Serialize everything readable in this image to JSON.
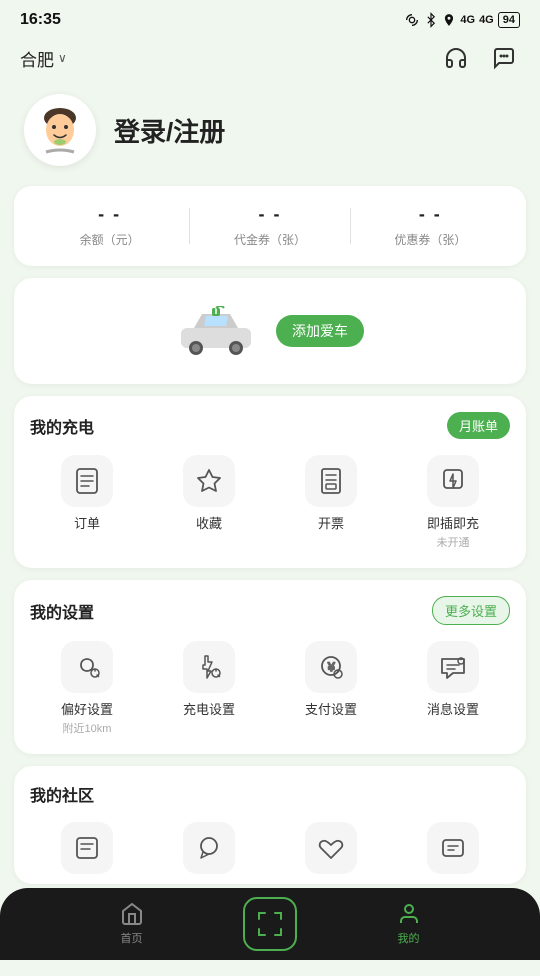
{
  "statusBar": {
    "time": "16:35",
    "icons": "NFC BT GPS Vol 4G 4G 94%"
  },
  "topNav": {
    "city": "合肥",
    "cityChevron": "∨",
    "headphoneIcon": "headphone-icon",
    "messageIcon": "message-icon"
  },
  "userHeader": {
    "loginText": "登录/注册"
  },
  "statsCard": {
    "items": [
      {
        "value": "- -",
        "label": "余额（元）"
      },
      {
        "value": "- -",
        "label": "代金券（张）"
      },
      {
        "value": "- -",
        "label": "优惠券（张）"
      }
    ]
  },
  "carCard": {
    "addButtonLabel": "添加爱车"
  },
  "chargingSection": {
    "title": "我的充电",
    "badge": "月账单",
    "items": [
      {
        "icon": "order",
        "label": "订单",
        "sublabel": ""
      },
      {
        "icon": "favorite",
        "label": "收藏",
        "sublabel": ""
      },
      {
        "icon": "invoice",
        "label": "开票",
        "sublabel": ""
      },
      {
        "icon": "instant",
        "label": "即插即充",
        "sublabel": "未开通"
      }
    ]
  },
  "settingsSection": {
    "title": "我的设置",
    "badge": "更多设置",
    "items": [
      {
        "icon": "preference",
        "label": "偏好设置",
        "sublabel": "附近10km"
      },
      {
        "icon": "charge-setting",
        "label": "充电设置",
        "sublabel": ""
      },
      {
        "icon": "payment",
        "label": "支付设置",
        "sublabel": ""
      },
      {
        "icon": "message-setting",
        "label": "消息设置",
        "sublabel": ""
      }
    ]
  },
  "communitySection": {
    "title": "我的社区",
    "items": [
      {
        "icon": "community1",
        "label": ""
      },
      {
        "icon": "community2",
        "label": ""
      },
      {
        "icon": "community3",
        "label": ""
      },
      {
        "icon": "community4",
        "label": ""
      }
    ]
  },
  "bottomNav": {
    "items": [
      {
        "label": "首页",
        "icon": "home-icon",
        "active": false
      },
      {
        "label": "",
        "icon": "scan-icon",
        "isCenter": true
      },
      {
        "label": "我的",
        "icon": "person-icon",
        "active": true
      }
    ]
  }
}
